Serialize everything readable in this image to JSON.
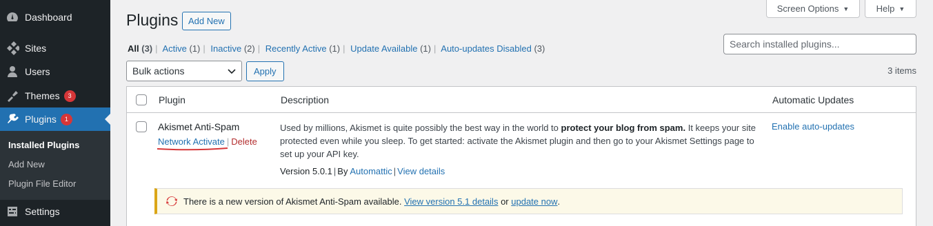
{
  "sidebar": {
    "items": [
      {
        "label": "Dashboard",
        "icon": "dashboard-icon"
      },
      {
        "label": "Sites",
        "icon": "sites-icon"
      },
      {
        "label": "Users",
        "icon": "users-icon"
      },
      {
        "label": "Themes",
        "icon": "themes-icon",
        "badge": "3"
      },
      {
        "label": "Plugins",
        "icon": "plugins-icon",
        "badge": "1"
      },
      {
        "label": "Settings",
        "icon": "settings-icon"
      }
    ],
    "submenu": [
      "Installed Plugins",
      "Add New",
      "Plugin File Editor"
    ]
  },
  "top": {
    "screen_options": "Screen Options",
    "help": "Help"
  },
  "header": {
    "title": "Plugins",
    "add_new": "Add New"
  },
  "filters": [
    {
      "label": "All",
      "count": "(3)"
    },
    {
      "label": "Active",
      "count": "(1)"
    },
    {
      "label": "Inactive",
      "count": "(2)"
    },
    {
      "label": "Recently Active",
      "count": "(1)"
    },
    {
      "label": "Update Available",
      "count": "(1)"
    },
    {
      "label": "Auto-updates Disabled",
      "count": "(3)"
    }
  ],
  "search": {
    "placeholder": "Search installed plugins..."
  },
  "bulk": {
    "selected": "Bulk actions",
    "apply": "Apply",
    "items_count": "3 items"
  },
  "table": {
    "headers": {
      "plugin": "Plugin",
      "description": "Description",
      "auto_updates": "Automatic Updates"
    },
    "row": {
      "name": "Akismet Anti-Spam",
      "action_activate": "Network Activate",
      "action_delete": "Delete",
      "desc_1": "Used by millions, Akismet is quite possibly the best way in the world to ",
      "desc_bold": "protect your blog from spam.",
      "desc_2": " It keeps your site protected even while you sleep. To get started: activate the Akismet plugin and then go to your Akismet Settings page to set up your API key.",
      "version": "Version 5.0.1",
      "by": "By",
      "author": "Automattic",
      "view_details": "View details",
      "auto_update_link": "Enable auto-updates"
    },
    "notice": {
      "text_1": "There is a new version of Akismet Anti-Spam available.",
      "link_1": "View version 5.1 details",
      "text_2": "or",
      "link_2": "update now",
      "end": "."
    }
  },
  "colors": {
    "accent": "#2271b1",
    "sidebar": "#1d2327",
    "badge": "#d63638",
    "annotation": "#d63638"
  }
}
